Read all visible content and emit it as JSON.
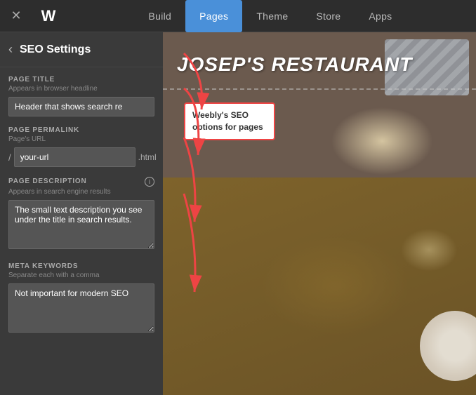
{
  "nav": {
    "close_icon": "✕",
    "logo": "W",
    "tabs": [
      {
        "label": "Build",
        "active": false
      },
      {
        "label": "Pages",
        "active": true
      },
      {
        "label": "Theme",
        "active": false
      },
      {
        "label": "Store",
        "active": false
      },
      {
        "label": "Apps",
        "active": false
      }
    ]
  },
  "panel": {
    "back_icon": "‹",
    "title": "SEO Settings",
    "fields": {
      "page_title": {
        "label": "PAGE TITLE",
        "sublabel": "Appears in browser headline",
        "value": "Header that shows search re"
      },
      "page_permalink": {
        "label": "PAGE PERMALINK",
        "sublabel": "Page's URL",
        "slash": "/",
        "value": "your-url",
        "extension": ".html"
      },
      "page_description": {
        "label": "PAGE DESCRIPTION",
        "sublabel": "Appears in search engine results",
        "value": "The small text description you see under the title in search results."
      },
      "meta_keywords": {
        "label": "META KEYWORDS",
        "sublabel": "Separate each with a comma",
        "value": "Not important for modern SEO"
      }
    }
  },
  "preview": {
    "restaurant_title": "JOSEP'S RESTAURANT",
    "tooltip": {
      "text": "Weebly's SEO options for pages"
    }
  },
  "info_icon_label": "i"
}
